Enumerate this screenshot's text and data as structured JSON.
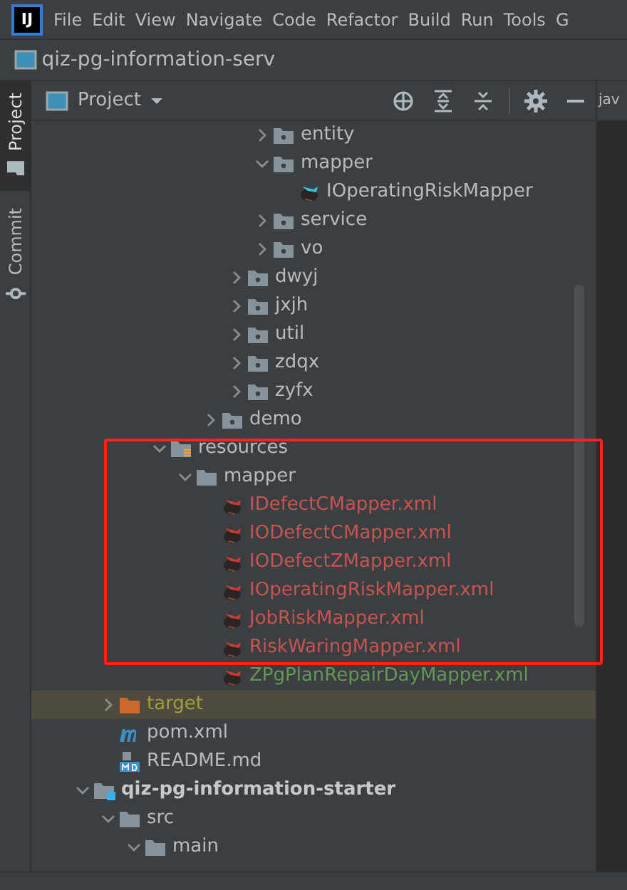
{
  "menu_bar": {
    "logo": "IJ",
    "items": [
      "File",
      "Edit",
      "View",
      "Navigate",
      "Code",
      "Refactor",
      "Build",
      "Run",
      "Tools",
      "G"
    ]
  },
  "title_bar": {
    "project": "qiz-pg-information-serv"
  },
  "side_tabs": [
    {
      "label": "Project",
      "selected": true
    },
    {
      "label": "Commit",
      "selected": false
    }
  ],
  "panel": {
    "title": "Project",
    "editor_tab": "jav"
  },
  "tree": [
    {
      "children": [
        {
          "children": [
            {
              "children": [
                {
                  "children": [
                    {
                      "children": [
                        {
                          "children": [
                            {
                              "children": [
                                {
                                  "label": "entity",
                                  "kind": "package",
                                  "expanded": false
                                },
                                {
                                  "label": "mapper",
                                  "kind": "package",
                                  "expanded": true,
                                  "children": [
                                    {
                                      "label": "IOperatingRiskMapper",
                                      "kind": "mapper-interface"
                                    }
                                  ]
                                },
                                {
                                  "label": "service",
                                  "kind": "package",
                                  "expanded": false
                                },
                                {
                                  "label": "vo",
                                  "kind": "package",
                                  "expanded": false
                                }
                              ]
                            },
                            {
                              "label": "dwyj",
                              "kind": "package",
                              "expanded": false
                            },
                            {
                              "label": "jxjh",
                              "kind": "package",
                              "expanded": false
                            },
                            {
                              "label": "util",
                              "kind": "package",
                              "expanded": false
                            },
                            {
                              "label": "zdqx",
                              "kind": "package",
                              "expanded": false
                            },
                            {
                              "label": "zyfx",
                              "kind": "package",
                              "expanded": false
                            }
                          ]
                        },
                        {
                          "label": "demo",
                          "kind": "package",
                          "expanded": false
                        }
                      ]
                    }
                  ]
                },
                {
                  "label": "resources",
                  "kind": "resources",
                  "expanded": true,
                  "children": [
                    {
                      "label": "mapper",
                      "kind": "folder",
                      "expanded": true,
                      "children": [
                        {
                          "label": "IDefectCMapper.xml",
                          "kind": "xml",
                          "color": "#c75450"
                        },
                        {
                          "label": "IODefectCMapper.xml",
                          "kind": "xml",
                          "color": "#c75450"
                        },
                        {
                          "label": "IODefectZMapper.xml",
                          "kind": "xml",
                          "color": "#c75450"
                        },
                        {
                          "label": "IOperatingRiskMapper.xml",
                          "kind": "xml",
                          "color": "#c75450"
                        },
                        {
                          "label": "JobRiskMapper.xml",
                          "kind": "xml",
                          "color": "#c75450"
                        },
                        {
                          "label": "RiskWaringMapper.xml",
                          "kind": "xml",
                          "color": "#c75450"
                        },
                        {
                          "label": "ZPgPlanRepairDayMapper.xml",
                          "kind": "xml",
                          "color": "#629755"
                        }
                      ]
                    }
                  ]
                }
              ]
            }
          ]
        },
        {
          "label": "target",
          "kind": "excluded",
          "expanded": false
        },
        {
          "label": "pom.xml",
          "kind": "maven"
        },
        {
          "label": "README.md",
          "kind": "markdown"
        }
      ]
    },
    {
      "label": "qiz-pg-information-starter",
      "kind": "module",
      "expanded": true,
      "children": [
        {
          "label": "src",
          "kind": "folder",
          "expanded": true,
          "children": [
            {
              "label": "main",
              "kind": "folder",
              "expanded": true
            }
          ]
        }
      ]
    }
  ]
}
